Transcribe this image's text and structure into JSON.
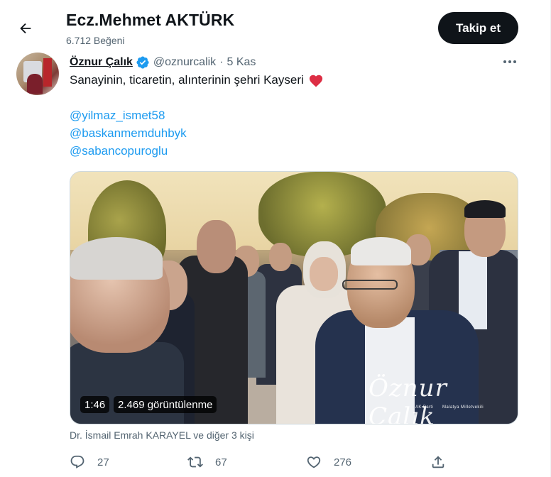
{
  "header": {
    "title": "Ecz.Mehmet AKTÜRK",
    "subtitle": "6.712 Beğeni",
    "follow_label": "Takip et"
  },
  "tweet": {
    "author_name": "Öznur Çalık",
    "handle": "@oznurcalik",
    "separator": "·",
    "time": "5 Kas",
    "text": "Sanayinin, ticaretin, alınterinin şehri Kayseri",
    "mentions": [
      "@yilmaz_ismet58",
      "@baskanmemduhbyk",
      "@sabancopuroglu"
    ],
    "video": {
      "duration": "1:46",
      "views": "2.469 görüntülenme",
      "watermark": {
        "script": "Öznur Çalık",
        "line1": "AK Parti",
        "line2": "Malatya Milletvekili"
      }
    },
    "likers": "Dr. İsmail Emrah KARAYEL ve diğer 3 kişi",
    "actions": {
      "replies": "27",
      "retweets": "67",
      "likes": "276"
    }
  },
  "colors": {
    "accent": "#1d9bf0",
    "text": "#0f1419",
    "muted": "#536471",
    "heart": "#f91880",
    "follow_bg": "#0f1419"
  }
}
